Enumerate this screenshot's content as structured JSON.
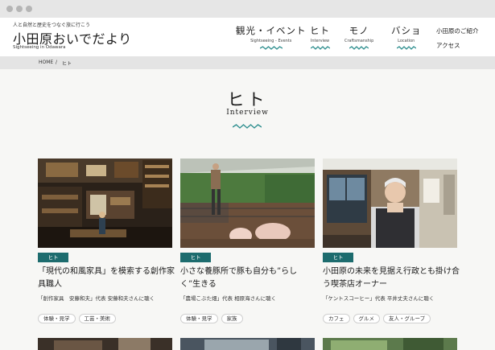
{
  "site": {
    "tagline": "人と自然と歴史をつなぐ旅に行こう",
    "name": "小田原おいでだより",
    "name_en": "Sightseeing in Odawara"
  },
  "nav": [
    {
      "jp": "観光・イベント",
      "en": "Sightseeing - Events"
    },
    {
      "jp": "ヒト",
      "en": "Interview"
    },
    {
      "jp": "モノ",
      "en": "Craftsmanship"
    },
    {
      "jp": "バショ",
      "en": "Location"
    }
  ],
  "subnav": [
    "小田原のご紹介",
    "アクセス"
  ],
  "breadcrumb": [
    "HOME",
    "/",
    "ヒト"
  ],
  "page": {
    "title": "ヒト",
    "subtitle": "Interview"
  },
  "cards": [
    {
      "tag": "ヒト",
      "title": "「現代の和風家具」を模索する創作家具職人",
      "author": "「創作家具　安藤和夫」代表 安藤和夫さんに聴く",
      "chips": [
        "体験・見学",
        "工芸・美術"
      ]
    },
    {
      "tag": "ヒト",
      "title": "小さな養豚所で豚も自分も”らしく”生きる",
      "author": "「農場こぶた畑」代表 相原海さんに聴く",
      "chips": [
        "体験・見学",
        "家族"
      ]
    },
    {
      "tag": "ヒト",
      "title": "小田原の未来を見据え行政とも掛け合う喫茶店オーナー",
      "author": "「ケントスコーヒー」代表 平井丈夫さんに聴く",
      "chips": [
        "カフェ",
        "グルメ",
        "友人・グループ"
      ]
    }
  ],
  "colors": {
    "accent": "#1d6c6e",
    "wave": "#2f8f8f",
    "background": "#f7f7f5"
  }
}
